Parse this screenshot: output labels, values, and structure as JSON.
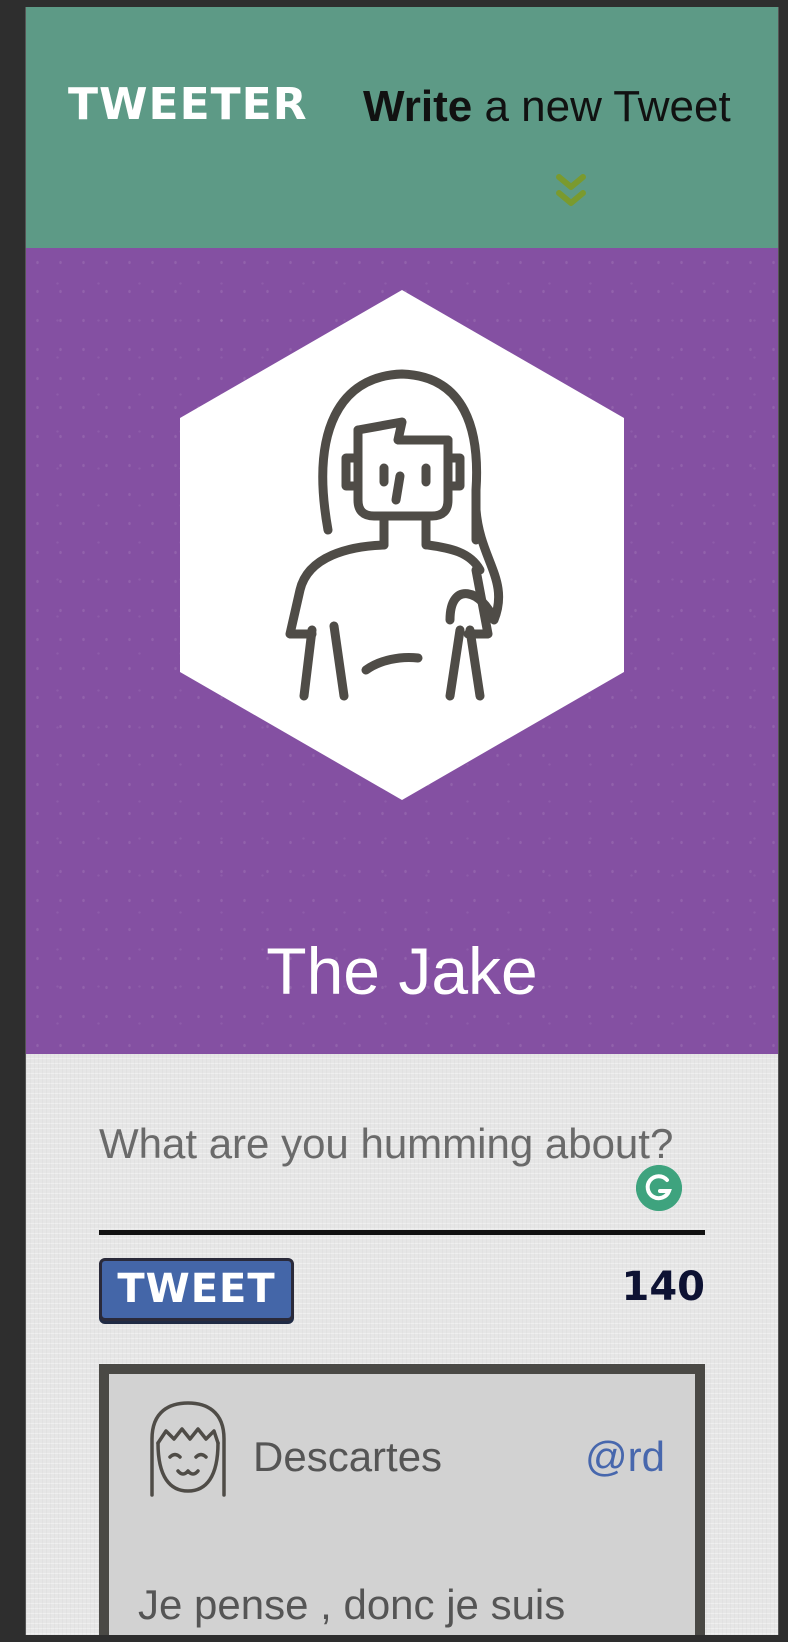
{
  "header": {
    "logo": "TWEETER",
    "compose_toggle_strong": "Write",
    "compose_toggle_rest": " a new Tweet"
  },
  "profile": {
    "name": "The Jake"
  },
  "compose": {
    "placeholder": "What are you humming about?",
    "tweet_button": "TWEET",
    "counter": "140"
  },
  "tweets": [
    {
      "author": "Descartes",
      "handle": "@rd",
      "text": "Je pense , donc je suis"
    }
  ],
  "colors": {
    "header_bg": "#5d9a86",
    "profile_bg": "#8450a2",
    "button_bg": "#4466a8",
    "handle": "#4767ad",
    "chevron": "#7a9a2e"
  },
  "icons": {
    "chevron": "double-chevron-down-icon",
    "grammarly": "grammarly-icon",
    "avatar": "avatar-icon"
  }
}
